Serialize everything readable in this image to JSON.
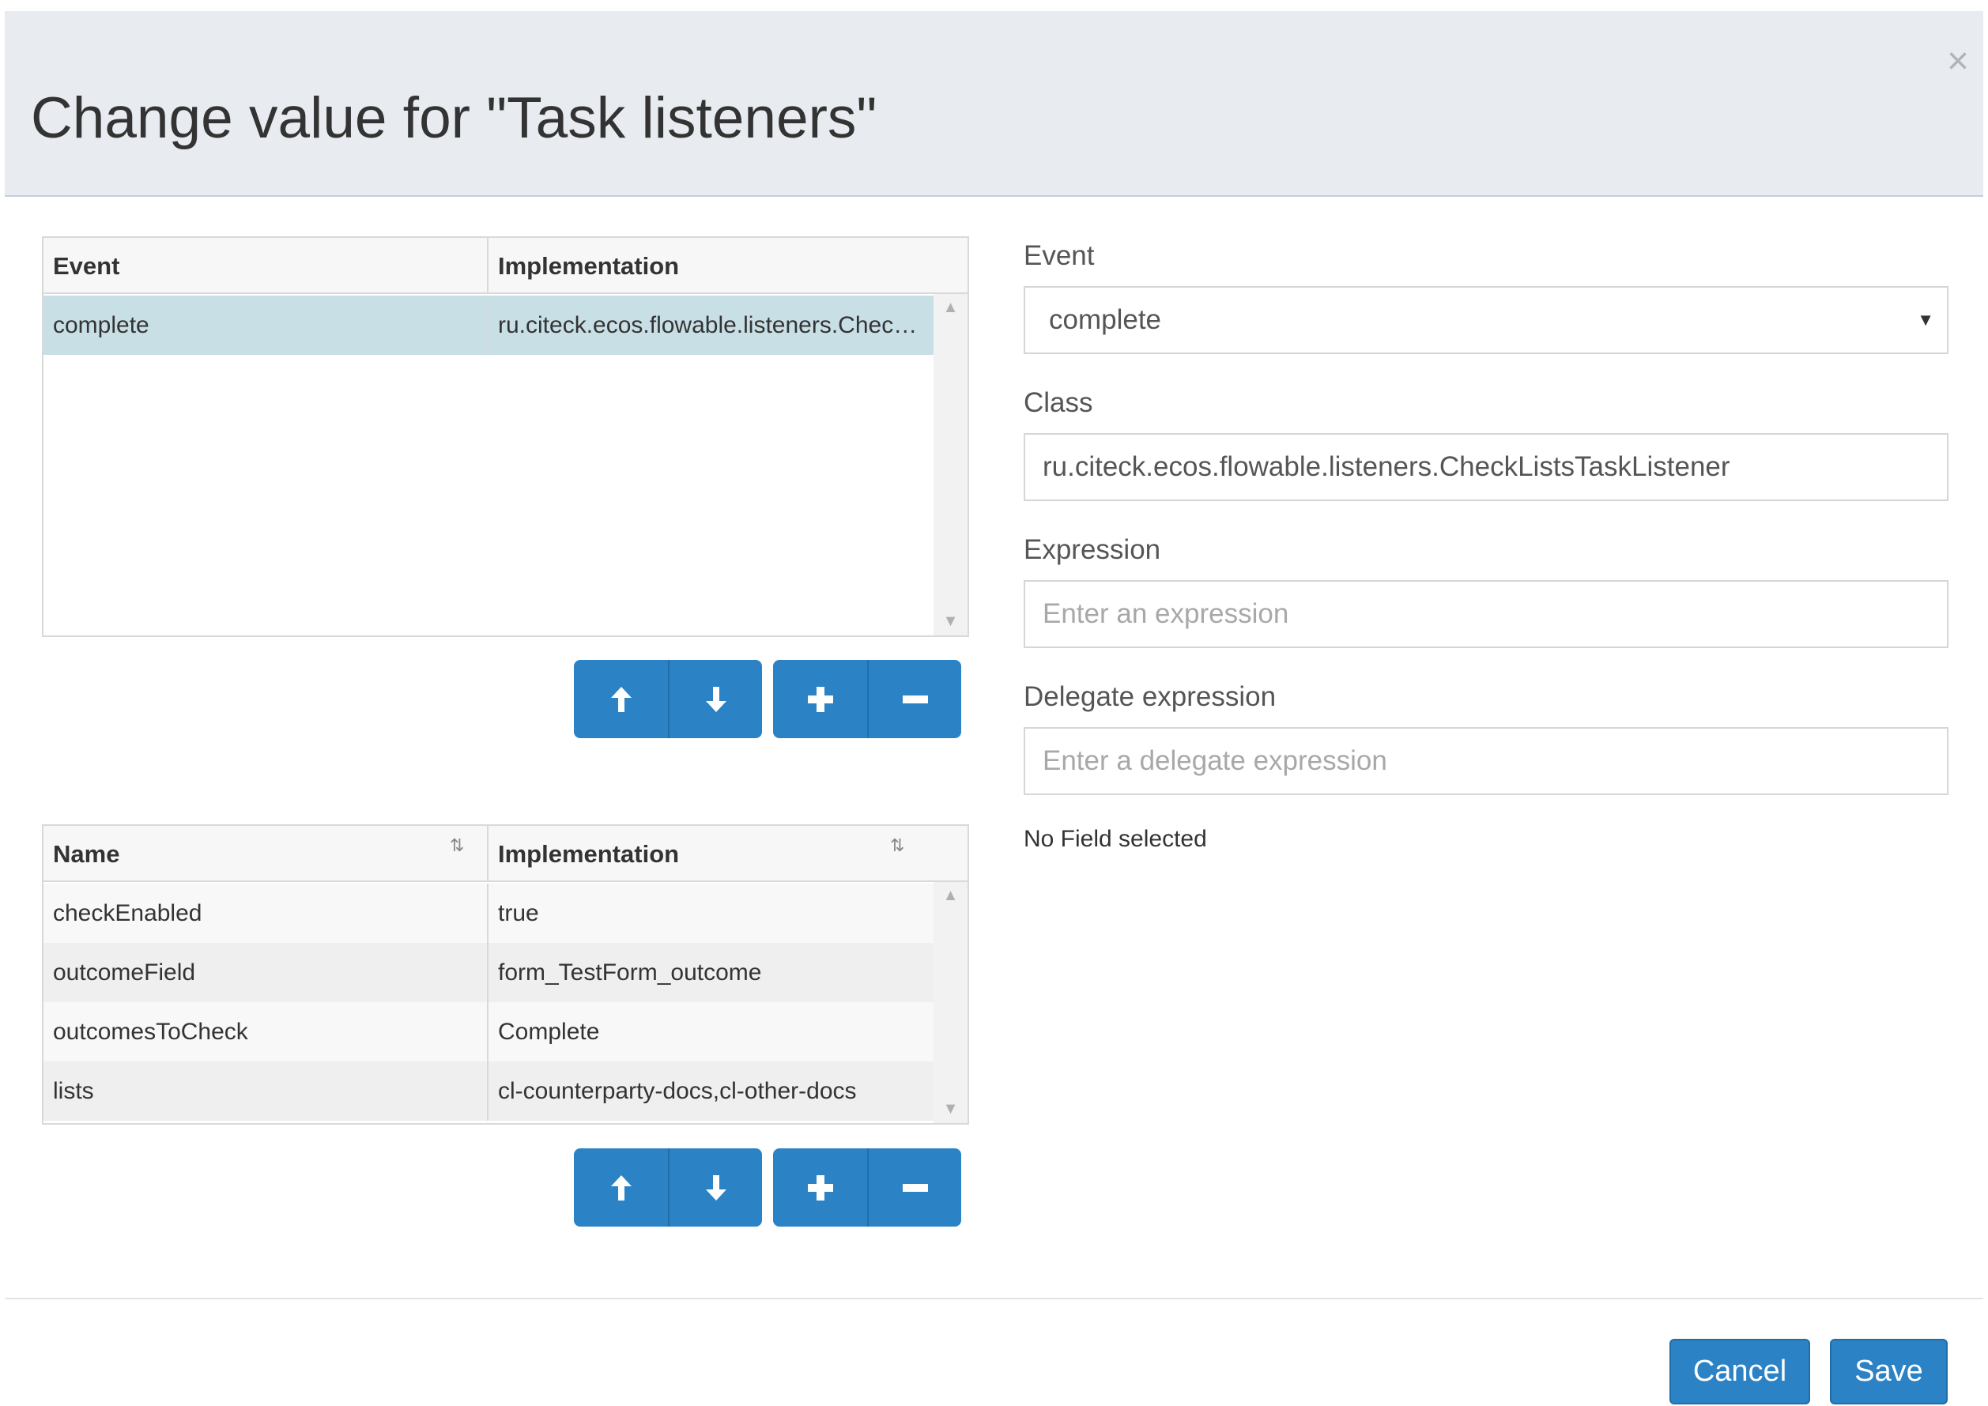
{
  "dialog": {
    "title": "Change value for \"Task listeners\"",
    "close_glyph": "×"
  },
  "listeners_grid": {
    "columns": [
      "Event",
      "Implementation"
    ],
    "rows": [
      {
        "event": "complete",
        "implementation": "ru.citeck.ecos.flowable.listeners.CheckListsTaskListener"
      }
    ],
    "selected_row": 0
  },
  "fields_grid": {
    "columns": [
      "Name",
      "Implementation"
    ],
    "rows": [
      {
        "name": "checkEnabled",
        "implementation": "true"
      },
      {
        "name": "outcomeField",
        "implementation": "form_TestForm_outcome"
      },
      {
        "name": "outcomesToCheck",
        "implementation": "Complete"
      },
      {
        "name": "lists",
        "implementation": "cl-counterparty-docs,cl-other-docs"
      }
    ]
  },
  "toolbar_buttons": {
    "icons": [
      "arrow-up-icon",
      "arrow-down-icon",
      "plus-icon",
      "minus-icon"
    ]
  },
  "form": {
    "event_label": "Event",
    "event_value": "complete",
    "class_label": "Class",
    "class_value": "ru.citeck.ecos.flowable.listeners.CheckListsTaskListener",
    "expression_label": "Expression",
    "expression_placeholder": "Enter an expression",
    "delegate_label": "Delegate expression",
    "delegate_placeholder": "Enter a delegate expression",
    "no_field_text": "No Field selected"
  },
  "footer": {
    "cancel_label": "Cancel",
    "save_label": "Save"
  },
  "colors": {
    "accent": "#2b82c4",
    "header_bg": "#e8ecf0",
    "selected_row": "#c9dfe6"
  }
}
